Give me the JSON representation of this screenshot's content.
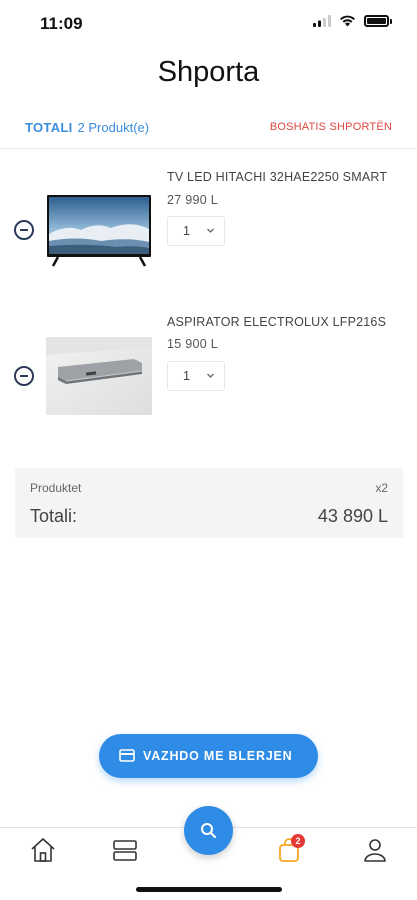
{
  "status_bar": {
    "time": "11:09"
  },
  "page": {
    "title": "Shporta"
  },
  "summary": {
    "total_label": "TOTALI",
    "product_count": "2 Produkt(e)",
    "empty_cart": "BOSHATIS SHPORTËN"
  },
  "cart_items": [
    {
      "name": "TV LED HITACHI 32HAE2250 SMART",
      "price": "27 990 L",
      "quantity": "1",
      "image_icon": "tv-image"
    },
    {
      "name": "ASPIRATOR ELECTROLUX LFP216S",
      "price": "15 900 L",
      "quantity": "1",
      "image_icon": "range-hood-image"
    }
  ],
  "totals": {
    "products_label": "Produktet",
    "products_count": "x2",
    "total_label": "Totali:",
    "total_value": "43 890 L"
  },
  "checkout": {
    "label": "VAZHDO ME BLERJEN",
    "icon": "credit-card-icon"
  },
  "bottom_nav": {
    "items": [
      "home-icon",
      "categories-icon",
      "search-icon",
      "cart-icon",
      "profile-icon"
    ],
    "cart_badge": "2",
    "active": "cart-icon"
  },
  "colors": {
    "accent": "#2f8ce6",
    "danger": "#e0463f",
    "cart_active": "#f5a623",
    "badge": "#e53935"
  }
}
